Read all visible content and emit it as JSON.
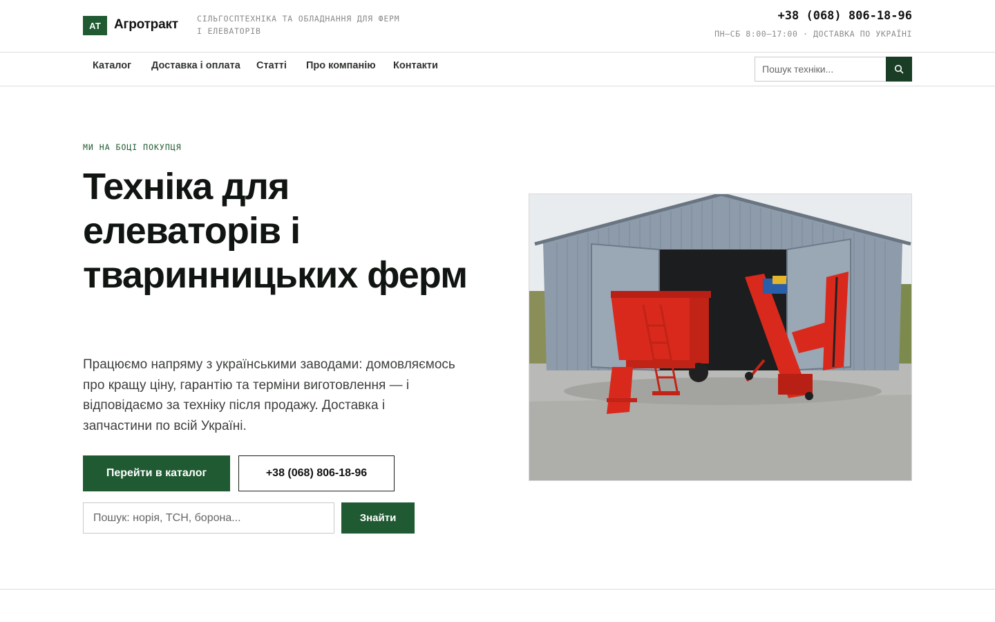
{
  "brand": {
    "logo_mark": "АТ",
    "name": "Агротракт",
    "tagline": "Сільгосптехніка та обладнання для ферм і елеваторів"
  },
  "contact": {
    "phone": "+38 (068) 806-18-96",
    "hours": "Пн–Сб 8:00–17:00 · доставка по Україні"
  },
  "nav": {
    "items": [
      {
        "label": "Каталог"
      },
      {
        "label": "Доставка і оплата"
      },
      {
        "label": "Статті"
      },
      {
        "label": "Про компанію"
      },
      {
        "label": "Контакти"
      }
    ],
    "search_placeholder": "Пошук техніки...",
    "search_icon": "search-icon"
  },
  "hero": {
    "eyebrow": "Ми на боці покупця",
    "title": "Техніка для елеваторів і тваринницьких ферм",
    "text": "Працюємо напряму з українськими заводами: домовляємось про кращу ціну, гарантію та терміни виготовлення — і відповідаємо за техніку після продажу. Доставка і запчастини по всій Україні.",
    "primary_button": "Перейти в каталог",
    "phone_button": "+38 (068) 806-18-96",
    "search_placeholder": "Пошук: норія, ТСН, борона...",
    "search_button": "Знайти",
    "photo": "hangar-with-red-feed-mixer-and-conveyor"
  },
  "colors": {
    "accent": "#1f5a32",
    "accent_dark": "#1a3d26",
    "machine_red": "#d8291c"
  }
}
